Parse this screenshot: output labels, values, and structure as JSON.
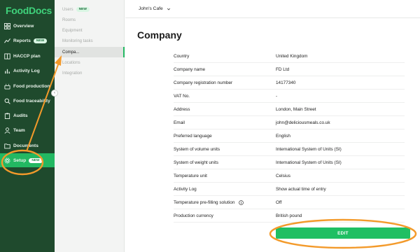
{
  "brand": {
    "logo_text": "FoodDocs",
    "accent_color": "#23b862",
    "sidebar_color": "#1f4a2d",
    "annotation_color": "#f39a2b"
  },
  "sidebar": {
    "items": [
      {
        "label": "Overview",
        "icon": "grid-icon"
      },
      {
        "label": "Reports",
        "icon": "reports-icon",
        "badge": "NEW"
      },
      {
        "label": "HACCP plan",
        "icon": "book-icon"
      },
      {
        "label": "Activity Log",
        "icon": "chart-icon"
      },
      {
        "label": "Food production",
        "icon": "pot-icon"
      },
      {
        "label": "Food traceability",
        "icon": "search-icon"
      },
      {
        "label": "Audits",
        "icon": "clipboard-icon"
      },
      {
        "label": "Team",
        "icon": "person-icon"
      },
      {
        "label": "Documents",
        "icon": "folder-icon"
      },
      {
        "label": "Setup",
        "icon": "gear-icon",
        "badge": "NEW",
        "active": true
      }
    ]
  },
  "subnav": {
    "items": [
      {
        "label": "Users",
        "badge": "NEW"
      },
      {
        "label": "Rooms"
      },
      {
        "label": "Equipment"
      },
      {
        "label": "Monitoring tasks"
      },
      {
        "label": "Compa...",
        "active": true
      },
      {
        "label": "Locations"
      },
      {
        "label": "Integration"
      }
    ]
  },
  "topbar": {
    "venue": "John's Cafe"
  },
  "page": {
    "title": "Company"
  },
  "company": {
    "rows": [
      {
        "label": "Country",
        "value": "United Kingdom"
      },
      {
        "label": "Company name",
        "value": "FD Ltd"
      },
      {
        "label": "Company registration number",
        "value": "14177340"
      },
      {
        "label": "VAT No.",
        "value": "-"
      },
      {
        "label": "Address",
        "value": "London, Main Street"
      },
      {
        "label": "Email",
        "value": "john@deliciousmeals.co.uk"
      },
      {
        "label": "Preferred language",
        "value": "English"
      },
      {
        "label": "System of volume units",
        "value": "International System of Units (SI)"
      },
      {
        "label": "System of weight units",
        "value": "International System of Units (SI)"
      },
      {
        "label": "Temperature unit",
        "value": "Celsius"
      },
      {
        "label": "Activity Log",
        "value": "Show actual time of entry"
      },
      {
        "label": "Temperature pre-filling solution",
        "value": "Off",
        "info": true
      },
      {
        "label": "Production currency",
        "value": "British pound"
      }
    ]
  },
  "actions": {
    "edit_label": "EDIT"
  }
}
